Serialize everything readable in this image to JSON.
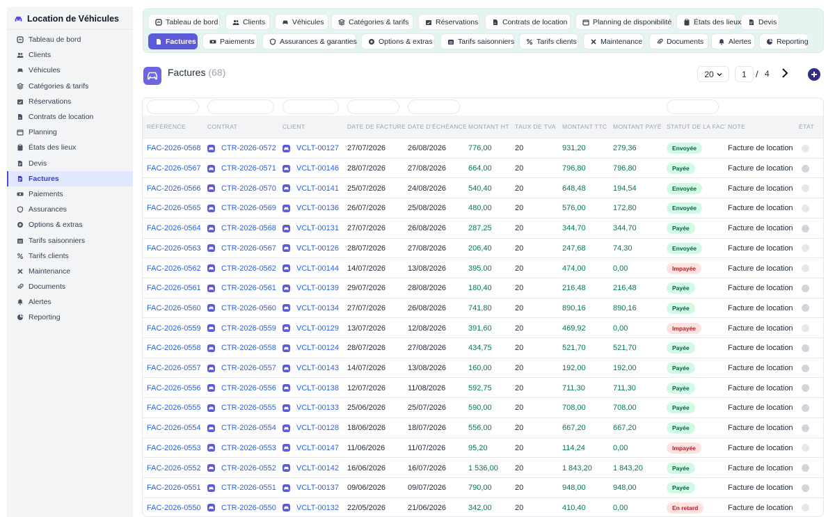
{
  "app": {
    "title": "Location de Véhicules"
  },
  "sidebar": {
    "items": [
      {
        "label": "Tableau de bord",
        "icon": "dashboard-icon",
        "active": false
      },
      {
        "label": "Clients",
        "icon": "users-icon",
        "active": false
      },
      {
        "label": "Véhicules",
        "icon": "car-icon",
        "active": false
      },
      {
        "label": "Catégories & tarifs",
        "icon": "layers-icon",
        "active": false
      },
      {
        "label": "Réservations",
        "icon": "calendar-check-icon",
        "active": false
      },
      {
        "label": "Contrats de location",
        "icon": "file-signature-icon",
        "active": false
      },
      {
        "label": "Planning",
        "icon": "calendar-icon",
        "active": false
      },
      {
        "label": "États des lieux",
        "icon": "clipboard-icon",
        "active": false
      },
      {
        "label": "Devis",
        "icon": "document-icon",
        "active": false
      },
      {
        "label": "Factures",
        "icon": "invoice-icon",
        "active": true
      },
      {
        "label": "Paiements",
        "icon": "money-icon",
        "active": false
      },
      {
        "label": "Assurances",
        "icon": "shield-icon",
        "active": false
      },
      {
        "label": "Options & extras",
        "icon": "plus-circle-icon",
        "active": false
      },
      {
        "label": "Tarifs saisonniers",
        "icon": "calendar-price-icon",
        "active": false
      },
      {
        "label": "Tarifs clients",
        "icon": "percent-icon",
        "active": false
      },
      {
        "label": "Maintenance",
        "icon": "tools-icon",
        "active": false
      },
      {
        "label": "Documents",
        "icon": "paperclip-icon",
        "active": false
      },
      {
        "label": "Alertes",
        "icon": "bell-icon",
        "active": false
      },
      {
        "label": "Reporting",
        "icon": "pie-chart-icon",
        "active": false
      }
    ]
  },
  "tabs": [
    {
      "label": "Tableau de bord",
      "icon": "dashboard-icon",
      "active": false
    },
    {
      "label": "Clients",
      "icon": "users-icon",
      "active": false
    },
    {
      "label": "Véhicules",
      "icon": "car-icon",
      "active": false
    },
    {
      "label": "Catégories & tarifs",
      "icon": "layers-icon",
      "active": false
    },
    {
      "label": "Réservations",
      "icon": "calendar-check-icon",
      "active": false
    },
    {
      "label": "Contrats de location",
      "icon": "file-signature-icon",
      "active": false
    },
    {
      "label": "Planning de disponibilité",
      "icon": "calendar-icon",
      "active": false
    },
    {
      "label": "États des lieux",
      "icon": "clipboard-icon",
      "active": false
    },
    {
      "label": "Devis",
      "icon": "document-icon",
      "active": false
    },
    {
      "label": "Factures",
      "icon": "invoice-icon",
      "active": true
    },
    {
      "label": "Paiements",
      "icon": "money-icon",
      "active": false
    },
    {
      "label": "Assurances & garanties",
      "icon": "shield-icon",
      "active": false
    },
    {
      "label": "Options & extras",
      "icon": "plus-circle-icon",
      "active": false
    },
    {
      "label": "Tarifs saisonniers",
      "icon": "calendar-price-icon",
      "active": false
    },
    {
      "label": "Tarifs clients",
      "icon": "percent-icon",
      "active": false
    },
    {
      "label": "Maintenance",
      "icon": "tools-icon",
      "active": false
    },
    {
      "label": "Documents",
      "icon": "paperclip-icon",
      "active": false
    },
    {
      "label": "Alertes",
      "icon": "bell-icon",
      "active": false
    },
    {
      "label": "Reporting",
      "icon": "pie-chart-icon",
      "active": false
    }
  ],
  "page": {
    "title": "Factures",
    "count": "(68)",
    "per_page": "20",
    "current_page": "1",
    "page_separator": "/",
    "total_pages": "4"
  },
  "table": {
    "columns": [
      "RÉFÉRENCE",
      "CONTRAT",
      "CLIENT",
      "DATE DE FACTURE",
      "DATE D'ÉCHÉANCE",
      "MONTANT HT",
      "TAUX DE TVA",
      "MONTANT TTC",
      "MONTANT PAYÉ",
      "STATUT DE LA FACTURE",
      "NOTE",
      "ÉTAT"
    ],
    "rows": [
      {
        "ref": "FAC-2026-0568",
        "contract": "CTR-2026-0572",
        "client": "VCLT-00127",
        "date": "27/07/2026",
        "due": "26/08/2026",
        "ht": "776,00",
        "tva": "20",
        "ttc": "931,20",
        "paid": "279,36",
        "status": "Envoyée",
        "note": "Facture de location",
        "state": "light"
      },
      {
        "ref": "FAC-2026-0567",
        "contract": "CTR-2026-0571",
        "client": "VCLT-00146",
        "date": "28/07/2026",
        "due": "27/08/2026",
        "ht": "664,00",
        "tva": "20",
        "ttc": "796,80",
        "paid": "796,80",
        "status": "Payée",
        "note": "Facture de location",
        "state": "grey"
      },
      {
        "ref": "FAC-2026-0566",
        "contract": "CTR-2026-0570",
        "client": "VCLT-00141",
        "date": "25/07/2026",
        "due": "24/08/2026",
        "ht": "540,40",
        "tva": "20",
        "ttc": "648,48",
        "paid": "194,54",
        "status": "Envoyée",
        "note": "Facture de location",
        "state": "light"
      },
      {
        "ref": "FAC-2026-0565",
        "contract": "CTR-2026-0569",
        "client": "VCLT-00136",
        "date": "26/07/2026",
        "due": "25/08/2026",
        "ht": "480,00",
        "tva": "20",
        "ttc": "576,00",
        "paid": "172,80",
        "status": "Envoyée",
        "note": "Facture de location",
        "state": "light"
      },
      {
        "ref": "FAC-2026-0564",
        "contract": "CTR-2026-0568",
        "client": "VCLT-00131",
        "date": "27/07/2026",
        "due": "26/08/2026",
        "ht": "287,25",
        "tva": "20",
        "ttc": "344,70",
        "paid": "344,70",
        "status": "Payée",
        "note": "Facture de location",
        "state": "grey"
      },
      {
        "ref": "FAC-2026-0563",
        "contract": "CTR-2026-0567",
        "client": "VCLT-00126",
        "date": "28/07/2026",
        "due": "27/08/2026",
        "ht": "206,40",
        "tva": "20",
        "ttc": "247,68",
        "paid": "74,30",
        "status": "Envoyée",
        "note": "Facture de location",
        "state": "light"
      },
      {
        "ref": "FAC-2026-0562",
        "contract": "CTR-2026-0562",
        "client": "VCLT-00144",
        "date": "14/07/2026",
        "due": "13/08/2026",
        "ht": "395,00",
        "tva": "20",
        "ttc": "474,00",
        "paid": "0,00",
        "status": "Impayée",
        "note": "Facture de location",
        "state": "light"
      },
      {
        "ref": "FAC-2026-0561",
        "contract": "CTR-2026-0561",
        "client": "VCLT-00139",
        "date": "29/07/2026",
        "due": "28/08/2026",
        "ht": "180,40",
        "tva": "20",
        "ttc": "216,48",
        "paid": "216,48",
        "status": "Payée",
        "note": "Facture de location",
        "state": "grey"
      },
      {
        "ref": "FAC-2026-0560",
        "contract": "CTR-2026-0560",
        "client": "VCLT-00134",
        "date": "27/07/2026",
        "due": "26/08/2026",
        "ht": "741,80",
        "tva": "20",
        "ttc": "890,16",
        "paid": "890,16",
        "status": "Payée",
        "note": "Facture de location",
        "state": "grey"
      },
      {
        "ref": "FAC-2026-0559",
        "contract": "CTR-2026-0559",
        "client": "VCLT-00129",
        "date": "13/07/2026",
        "due": "12/08/2026",
        "ht": "391,60",
        "tva": "20",
        "ttc": "469,92",
        "paid": "0,00",
        "status": "Impayée",
        "note": "Facture de location",
        "state": "light"
      },
      {
        "ref": "FAC-2026-0558",
        "contract": "CTR-2026-0558",
        "client": "VCLT-00124",
        "date": "28/07/2026",
        "due": "27/08/2026",
        "ht": "434,75",
        "tva": "20",
        "ttc": "521,70",
        "paid": "521,70",
        "status": "Payée",
        "note": "Facture de location",
        "state": "grey"
      },
      {
        "ref": "FAC-2026-0557",
        "contract": "CTR-2026-0557",
        "client": "VCLT-00143",
        "date": "14/07/2026",
        "due": "13/08/2026",
        "ht": "160,00",
        "tva": "20",
        "ttc": "192,00",
        "paid": "192,00",
        "status": "Payée",
        "note": "Facture de location",
        "state": "grey"
      },
      {
        "ref": "FAC-2026-0556",
        "contract": "CTR-2026-0556",
        "client": "VCLT-00138",
        "date": "12/07/2026",
        "due": "11/08/2026",
        "ht": "592,75",
        "tva": "20",
        "ttc": "711,30",
        "paid": "711,30",
        "status": "Payée",
        "note": "Facture de location",
        "state": "grey"
      },
      {
        "ref": "FAC-2026-0555",
        "contract": "CTR-2026-0555",
        "client": "VCLT-00133",
        "date": "25/06/2026",
        "due": "25/07/2026",
        "ht": "590,00",
        "tva": "20",
        "ttc": "708,00",
        "paid": "708,00",
        "status": "Payée",
        "note": "Facture de location",
        "state": "grey"
      },
      {
        "ref": "FAC-2026-0554",
        "contract": "CTR-2026-0554",
        "client": "VCLT-00128",
        "date": "18/06/2026",
        "due": "18/07/2026",
        "ht": "556,00",
        "tva": "20",
        "ttc": "667,20",
        "paid": "667,20",
        "status": "Payée",
        "note": "Facture de location",
        "state": "grey"
      },
      {
        "ref": "FAC-2026-0553",
        "contract": "CTR-2026-0553",
        "client": "VCLT-00147",
        "date": "11/06/2026",
        "due": "11/07/2026",
        "ht": "95,20",
        "tva": "20",
        "ttc": "114,24",
        "paid": "0,00",
        "status": "Impayée",
        "note": "Facture de location",
        "state": "light"
      },
      {
        "ref": "FAC-2026-0552",
        "contract": "CTR-2026-0552",
        "client": "VCLT-00142",
        "date": "16/06/2026",
        "due": "16/07/2026",
        "ht": "1 536,00",
        "tva": "20",
        "ttc": "1 843,20",
        "paid": "1 843,20",
        "status": "Payée",
        "note": "Facture de location",
        "state": "grey"
      },
      {
        "ref": "FAC-2026-0551",
        "contract": "CTR-2026-0551",
        "client": "VCLT-00137",
        "date": "09/06/2026",
        "due": "09/07/2026",
        "ht": "790,00",
        "tva": "20",
        "ttc": "948,00",
        "paid": "948,00",
        "status": "Payée",
        "note": "Facture de location",
        "state": "grey"
      },
      {
        "ref": "FAC-2026-0550",
        "contract": "CTR-2026-0550",
        "client": "VCLT-00132",
        "date": "22/05/2026",
        "due": "21/06/2026",
        "ht": "342,00",
        "tva": "20",
        "ttc": "410,40",
        "paid": "0,00",
        "status": "En retard",
        "note": "Facture de location",
        "state": "light"
      }
    ]
  },
  "colors": {
    "accent": "#5b5bd6",
    "link": "#2563eb",
    "amount": "#047857",
    "tabbar_bg": "#e6f4f1"
  }
}
